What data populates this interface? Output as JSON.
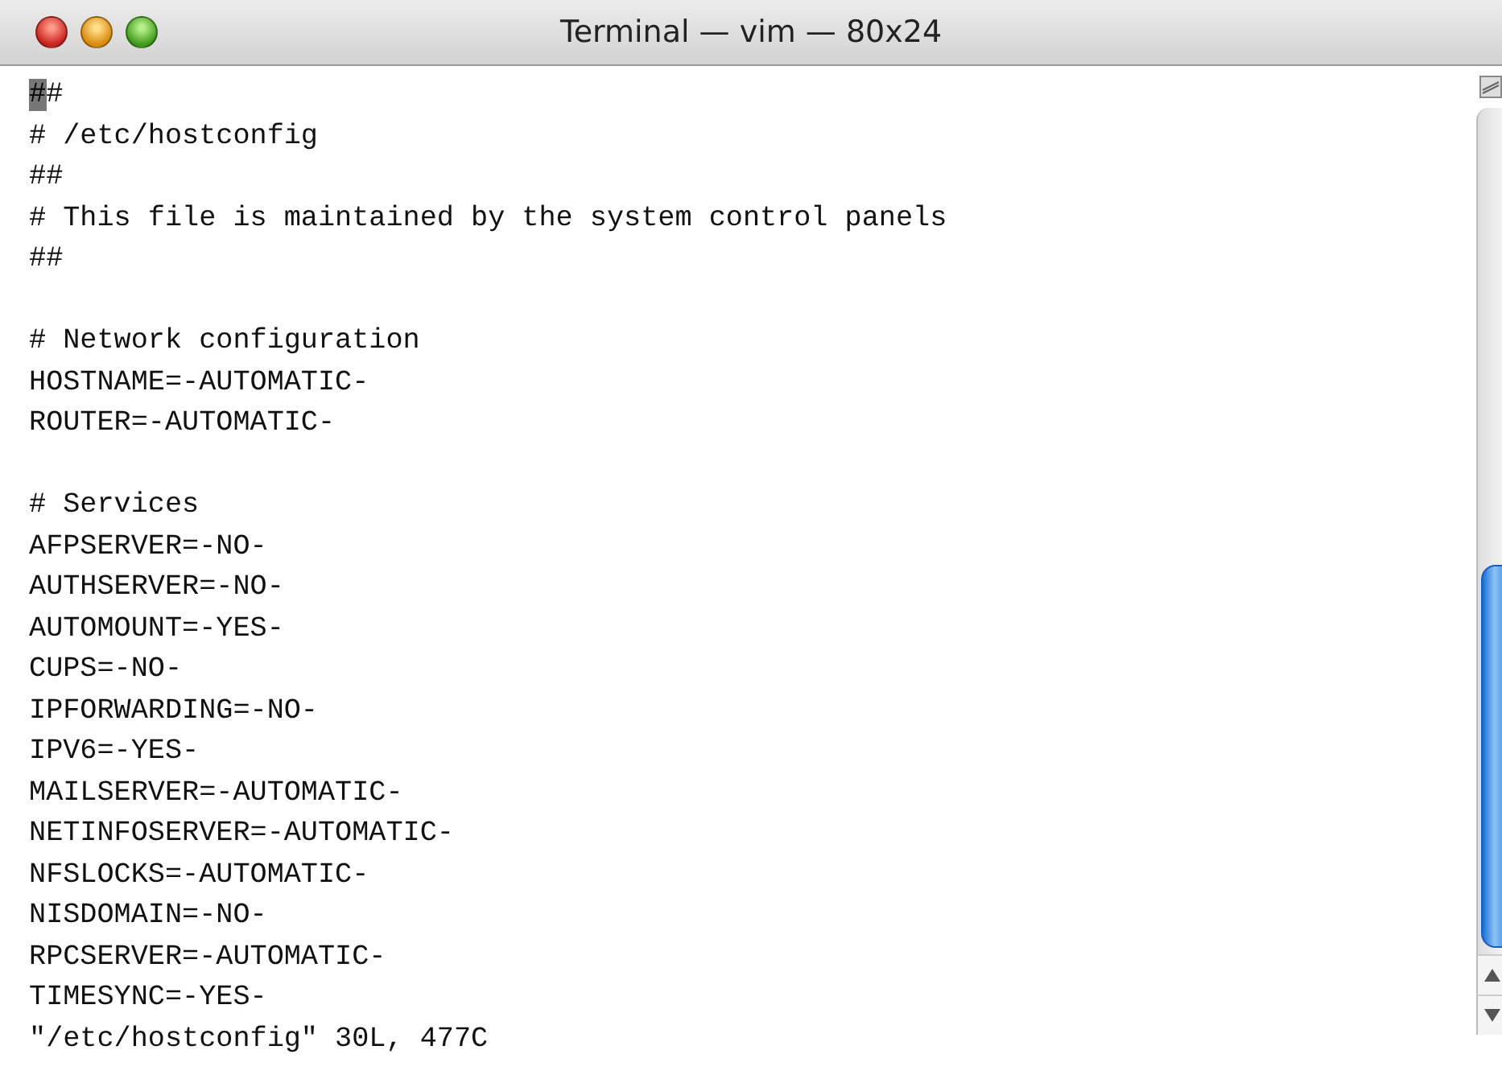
{
  "window": {
    "title": "Terminal — vim — 80x24"
  },
  "lines": [
    {
      "kind": "text",
      "text": "##",
      "cursor": true
    },
    {
      "kind": "text",
      "text": "# /etc/hostconfig",
      "cursor": false
    },
    {
      "kind": "text",
      "text": "##",
      "cursor": false
    },
    {
      "kind": "text",
      "text": "# This file is maintained by the system control panels",
      "cursor": false
    },
    {
      "kind": "text",
      "text": "##",
      "cursor": false
    },
    {
      "kind": "blank"
    },
    {
      "kind": "text",
      "text": "# Network configuration",
      "cursor": false
    },
    {
      "kind": "text",
      "text": "HOSTNAME=-AUTOMATIC-",
      "cursor": false
    },
    {
      "kind": "text",
      "text": "ROUTER=-AUTOMATIC-",
      "cursor": false
    },
    {
      "kind": "blank"
    },
    {
      "kind": "text",
      "text": "# Services",
      "cursor": false
    },
    {
      "kind": "text",
      "text": "AFPSERVER=-NO-",
      "cursor": false
    },
    {
      "kind": "text",
      "text": "AUTHSERVER=-NO-",
      "cursor": false
    },
    {
      "kind": "text",
      "text": "AUTOMOUNT=-YES-",
      "cursor": false
    },
    {
      "kind": "text",
      "text": "CUPS=-NO-",
      "cursor": false
    },
    {
      "kind": "text",
      "text": "IPFORWARDING=-NO-",
      "cursor": false
    },
    {
      "kind": "text",
      "text": "IPV6=-YES-",
      "cursor": false
    },
    {
      "kind": "text",
      "text": "MAILSERVER=-AUTOMATIC-",
      "cursor": false
    },
    {
      "kind": "text",
      "text": "NETINFOSERVER=-AUTOMATIC-",
      "cursor": false
    },
    {
      "kind": "text",
      "text": "NFSLOCKS=-AUTOMATIC-",
      "cursor": false
    },
    {
      "kind": "text",
      "text": "NISDOMAIN=-NO-",
      "cursor": false
    },
    {
      "kind": "text",
      "text": "RPCSERVER=-AUTOMATIC-",
      "cursor": false
    },
    {
      "kind": "text",
      "text": "TIMESYNC=-YES-",
      "cursor": false
    },
    {
      "kind": "text",
      "text": "\"/etc/hostconfig\" 30L, 477C",
      "cursor": false
    }
  ]
}
